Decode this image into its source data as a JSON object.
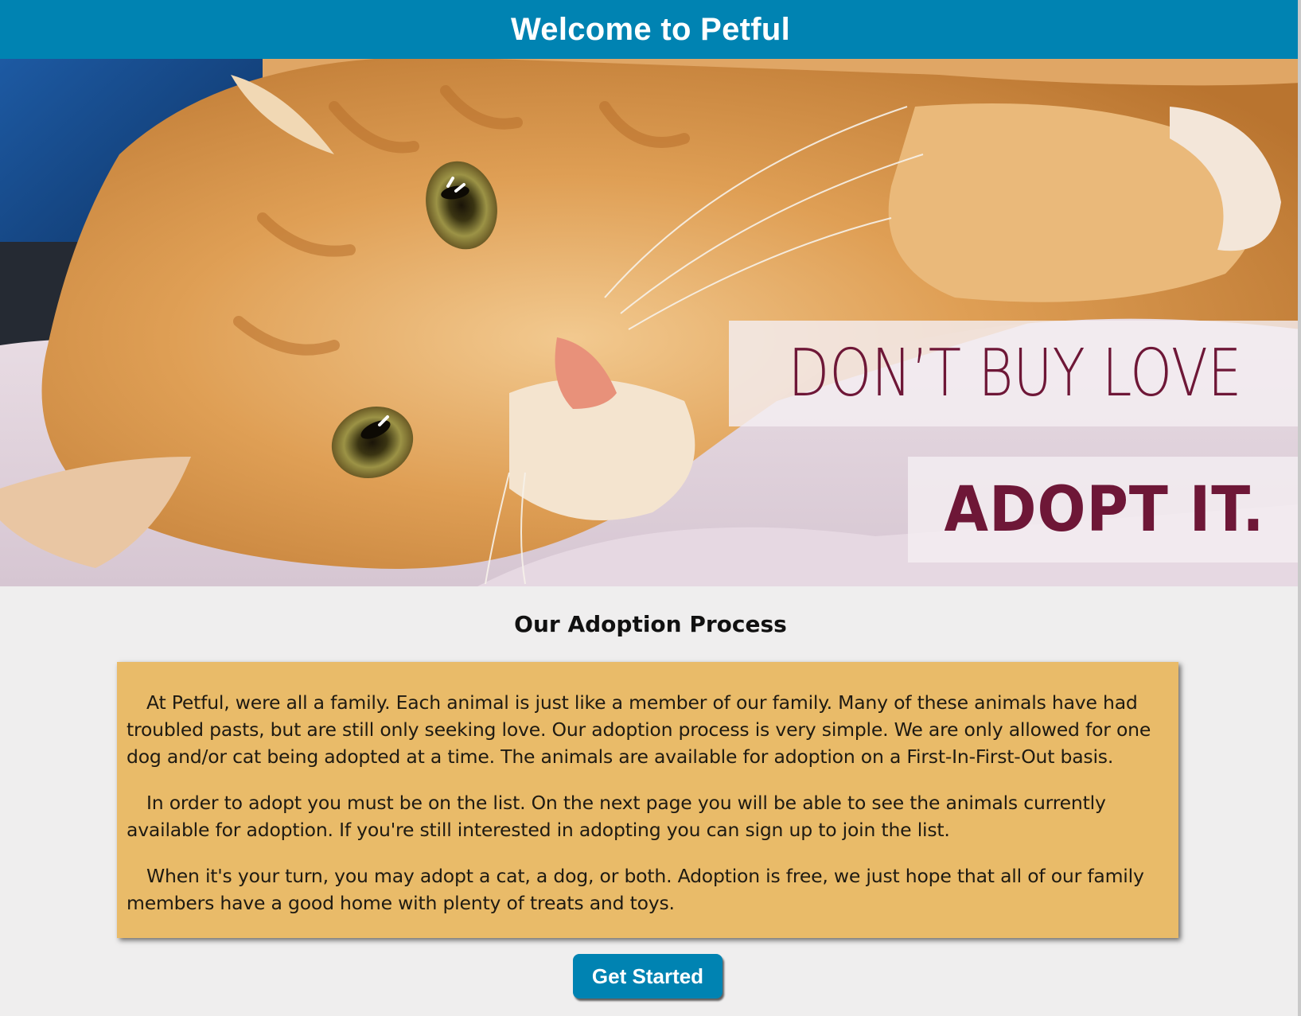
{
  "header": {
    "title": "Welcome to Petful"
  },
  "hero": {
    "image_description": "orange tabby cat lying on towel",
    "banner_line_1": "DON’T BUY LOVE",
    "banner_line_2": "ADOPT IT.",
    "banner_text_color": "#6e1737"
  },
  "main": {
    "section_title": "Our Adoption Process",
    "paragraphs": [
      "At Petful, were all a family. Each animal is just like a member of our family. Many of these animals have had troubled pasts, but are still only seeking love. Our adoption process is very simple. We are only allowed for one dog and/or cat being adopted at a time. The animals are available for adoption on a First-In-First-Out basis.",
      "In order to adopt you must be on the list. On the next page you will be able to see the animals currently available for adoption. If you're still interested in adopting you can sign up to join the list.",
      "When it's your turn, you may adopt a cat, a dog, or both. Adoption is free, we just hope that all of our family members have a good home with plenty of treats and toys."
    ],
    "cta_label": "Get Started"
  },
  "colors": {
    "header_bg": "#0083b2",
    "card_bg": "#e9bb69",
    "page_bg": "#efeeee",
    "button_bg": "#0083b2"
  }
}
